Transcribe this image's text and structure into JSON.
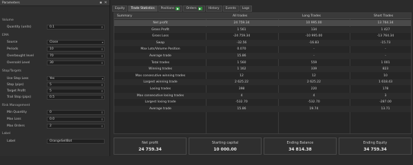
{
  "panel": {
    "title": "Parameters",
    "groups": [
      {
        "label": "Volume",
        "rows": [
          {
            "label": "Quantity (units)",
            "value": "0.1"
          }
        ]
      },
      {
        "label": "EMA",
        "rows": [
          {
            "label": "Source",
            "value": "Close"
          },
          {
            "label": "Periods",
            "value": "10"
          },
          {
            "label": "Overbought level",
            "value": "70"
          },
          {
            "label": "Oversold Level",
            "value": "30"
          }
        ]
      },
      {
        "label": "Stop/Targets",
        "rows": [
          {
            "label": "Use Stop Loss",
            "value": "Yes"
          },
          {
            "label": "Stop (pips)",
            "value": "5"
          },
          {
            "label": "Target Profit",
            "value": "5"
          },
          {
            "label": "Trail Stop (pips)",
            "value": "0.5"
          }
        ]
      },
      {
        "label": "Risk Management",
        "rows": [
          {
            "label": "Min Quantity",
            "value": "0"
          },
          {
            "label": "Max Loss",
            "value": "0.0"
          },
          {
            "label": "Max Orders",
            "value": "2"
          }
        ]
      },
      {
        "label": "Label",
        "rows": [
          {
            "label": "Label",
            "value": "OrangeSellBot"
          }
        ]
      }
    ]
  },
  "tabs": [
    "Equity",
    "Trade Statistics",
    "Positions",
    "Orders",
    "History",
    "Events",
    "Logs"
  ],
  "table": {
    "headers": [
      "Summary",
      "All trades",
      "Long Trades",
      "Short Trades"
    ],
    "rows": [
      [
        "Net profit",
        "24 759.34",
        "10 995.00",
        "13 764.34"
      ],
      [
        "Gross Profit",
        "1 561",
        "134",
        "1 427"
      ],
      [
        "Gross Loss",
        "-24 759.34",
        "-10 995.00",
        "-13 764.34"
      ],
      [
        "Swap",
        "-32.56",
        "-16.83",
        "-15.73"
      ],
      [
        "Max Lots/Volume Position",
        "0.070",
        "-",
        "-"
      ],
      [
        "Average trade",
        "15.86",
        "-",
        "-"
      ],
      [
        "Total trades",
        "1 560",
        "559",
        "1 001"
      ],
      [
        "Winning trades",
        "1 162",
        "339",
        "823"
      ],
      [
        "Max consecutive winning trades",
        "12",
        "12",
        "10"
      ],
      [
        "Largest winning trade",
        "2 625.22",
        "2 625.22",
        "1 618.43"
      ],
      [
        "Losing trades",
        "398",
        "220",
        "178"
      ],
      [
        "Max consecutive losing trades",
        "4",
        "4",
        "3"
      ],
      [
        "Largest losing trade",
        "-532.70",
        "-532.70",
        "-287.00"
      ],
      [
        "Average trade",
        "15.86",
        "19.74",
        "13.71"
      ]
    ]
  },
  "summary": [
    {
      "label": "Net profit",
      "value": "24 759.34"
    },
    {
      "label": "Starting capital",
      "value": "10 000.00"
    },
    {
      "label": "Ending Balance",
      "value": "34 814.38"
    },
    {
      "label": "Ending Equity",
      "value": "34 759.34"
    }
  ]
}
